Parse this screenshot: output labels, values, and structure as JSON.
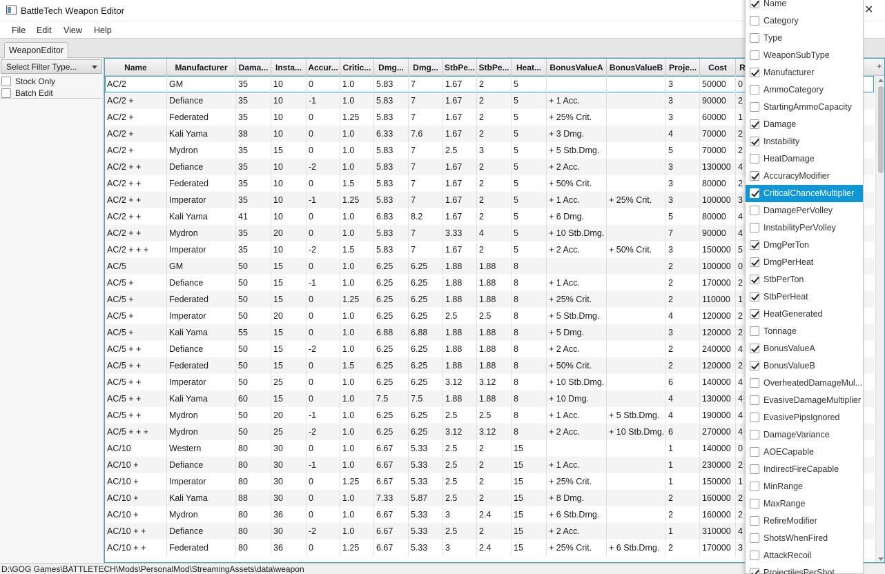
{
  "window": {
    "title": "BattleTech Weapon Editor",
    "close_glyph": "✕"
  },
  "menu": [
    "File",
    "Edit",
    "View",
    "Help"
  ],
  "tabs": [
    "WeaponEditor"
  ],
  "left_panel": {
    "filter_placeholder": "Select Filter Type...",
    "checkboxes": [
      {
        "label": "Stock Only",
        "checked": false
      },
      {
        "label": "Batch Edit",
        "checked": false
      }
    ]
  },
  "table": {
    "add_column_glyph": "+",
    "columns": [
      "Name",
      "Manufacturer",
      "Dama...",
      "Insta...",
      "Accur...",
      "Critic...",
      "Dmg...",
      "Dmg...",
      "StbPe...",
      "StbPe...",
      "Heat...",
      "BonusValueA",
      "BonusValueB",
      "Proje...",
      "Cost",
      "R"
    ],
    "rows": [
      [
        "AC/2",
        "GM",
        "35",
        "10",
        "0",
        "1.0",
        "5.83",
        "7",
        "1.67",
        "2",
        "5",
        "",
        "",
        "3",
        "50000",
        "0"
      ],
      [
        "AC/2 +",
        "Defiance",
        "35",
        "10",
        "-1",
        "1.0",
        "5.83",
        "7",
        "1.67",
        "2",
        "5",
        "+ 1 Acc.",
        "",
        "3",
        "90000",
        "2"
      ],
      [
        "AC/2 +",
        "Federated",
        "35",
        "10",
        "0",
        "1.25",
        "5.83",
        "7",
        "1.67",
        "2",
        "5",
        "+ 25% Crit.",
        "",
        "3",
        "60000",
        "1"
      ],
      [
        "AC/2 +",
        "Kali Yama",
        "38",
        "10",
        "0",
        "1.0",
        "6.33",
        "7.6",
        "1.67",
        "2",
        "5",
        "+ 3 Dmg.",
        "",
        "4",
        "70000",
        "2"
      ],
      [
        "AC/2 +",
        "Mydron",
        "35",
        "15",
        "0",
        "1.0",
        "5.83",
        "7",
        "2.5",
        "3",
        "5",
        "+ 5 Stb.Dmg.",
        "",
        "5",
        "70000",
        "2"
      ],
      [
        "AC/2 + +",
        "Defiance",
        "35",
        "10",
        "-2",
        "1.0",
        "5.83",
        "7",
        "1.67",
        "2",
        "5",
        "+ 2 Acc.",
        "",
        "3",
        "130000",
        "4"
      ],
      [
        "AC/2 + +",
        "Federated",
        "35",
        "10",
        "0",
        "1.5",
        "5.83",
        "7",
        "1.67",
        "2",
        "5",
        "+ 50% Crit.",
        "",
        "3",
        "80000",
        "2"
      ],
      [
        "AC/2 + +",
        "Imperator",
        "35",
        "10",
        "-1",
        "1.25",
        "5.83",
        "7",
        "1.67",
        "2",
        "5",
        "+ 1 Acc.",
        "+ 25% Crit.",
        "3",
        "100000",
        "3"
      ],
      [
        "AC/2 + +",
        "Kali Yama",
        "41",
        "10",
        "0",
        "1.0",
        "6.83",
        "8.2",
        "1.67",
        "2",
        "5",
        "+ 6 Dmg.",
        "",
        "5",
        "80000",
        "4"
      ],
      [
        "AC/2 + +",
        "Mydron",
        "35",
        "20",
        "0",
        "1.0",
        "5.83",
        "7",
        "3.33",
        "4",
        "5",
        "+ 10 Stb.Dmg.",
        "",
        "7",
        "90000",
        "4"
      ],
      [
        "AC/2 + + +",
        "Imperator",
        "35",
        "10",
        "-2",
        "1.5",
        "5.83",
        "7",
        "1.67",
        "2",
        "5",
        "+ 2 Acc.",
        "+ 50% Crit.",
        "3",
        "150000",
        "5"
      ],
      [
        "AC/5",
        "GM",
        "50",
        "15",
        "0",
        "1.0",
        "6.25",
        "6.25",
        "1.88",
        "1.88",
        "8",
        "",
        "",
        "2",
        "100000",
        "0"
      ],
      [
        "AC/5 +",
        "Defiance",
        "50",
        "15",
        "-1",
        "1.0",
        "6.25",
        "6.25",
        "1.88",
        "1.88",
        "8",
        "+ 1 Acc.",
        "",
        "2",
        "170000",
        "2"
      ],
      [
        "AC/5 +",
        "Federated",
        "50",
        "15",
        "0",
        "1.25",
        "6.25",
        "6.25",
        "1.88",
        "1.88",
        "8",
        "+ 25% Crit.",
        "",
        "2",
        "110000",
        "1"
      ],
      [
        "AC/5 +",
        "Imperator",
        "50",
        "20",
        "0",
        "1.0",
        "6.25",
        "6.25",
        "2.5",
        "2.5",
        "8",
        "+ 5 Stb.Dmg.",
        "",
        "4",
        "120000",
        "2"
      ],
      [
        "AC/5 +",
        "Kali Yama",
        "55",
        "15",
        "0",
        "1.0",
        "6.88",
        "6.88",
        "1.88",
        "1.88",
        "8",
        "+ 5 Dmg.",
        "",
        "3",
        "120000",
        "2"
      ],
      [
        "AC/5 + +",
        "Defiance",
        "50",
        "15",
        "-2",
        "1.0",
        "6.25",
        "6.25",
        "1.88",
        "1.88",
        "8",
        "+ 2 Acc.",
        "",
        "2",
        "240000",
        "4"
      ],
      [
        "AC/5 + +",
        "Federated",
        "50",
        "15",
        "0",
        "1.5",
        "6.25",
        "6.25",
        "1.88",
        "1.88",
        "8",
        "+ 50% Crit.",
        "",
        "2",
        "120000",
        "2"
      ],
      [
        "AC/5 + +",
        "Imperator",
        "50",
        "25",
        "0",
        "1.0",
        "6.25",
        "6.25",
        "3.12",
        "3.12",
        "8",
        "+ 10 Stb.Dmg.",
        "",
        "6",
        "140000",
        "4"
      ],
      [
        "AC/5 + +",
        "Kali Yama",
        "60",
        "15",
        "0",
        "1.0",
        "7.5",
        "7.5",
        "1.88",
        "1.88",
        "8",
        "+ 10 Dmg.",
        "",
        "4",
        "130000",
        "4"
      ],
      [
        "AC/5 + +",
        "Mydron",
        "50",
        "20",
        "-1",
        "1.0",
        "6.25",
        "6.25",
        "2.5",
        "2.5",
        "8",
        "+ 1 Acc.",
        "+ 5 Stb.Dmg.",
        "4",
        "190000",
        "4"
      ],
      [
        "AC/5 + + +",
        "Mydron",
        "50",
        "25",
        "-2",
        "1.0",
        "6.25",
        "6.25",
        "3.12",
        "3.12",
        "8",
        "+ 2 Acc.",
        "+ 10 Stb.Dmg.",
        "6",
        "270000",
        "4"
      ],
      [
        "AC/10",
        "Western",
        "80",
        "30",
        "0",
        "1.0",
        "6.67",
        "5.33",
        "2.5",
        "2",
        "15",
        "",
        "",
        "1",
        "140000",
        "0"
      ],
      [
        "AC/10 +",
        "Defiance",
        "80",
        "30",
        "-1",
        "1.0",
        "6.67",
        "5.33",
        "2.5",
        "2",
        "15",
        "+ 1 Acc.",
        "",
        "1",
        "230000",
        "2"
      ],
      [
        "AC/10 +",
        "Imperator",
        "80",
        "30",
        "0",
        "1.25",
        "6.67",
        "5.33",
        "2.5",
        "2",
        "15",
        "+ 25% Crit.",
        "",
        "1",
        "150000",
        "1"
      ],
      [
        "AC/10 +",
        "Kali Yama",
        "88",
        "30",
        "0",
        "1.0",
        "7.33",
        "5.87",
        "2.5",
        "2",
        "15",
        "+ 8 Dmg.",
        "",
        "2",
        "160000",
        "2"
      ],
      [
        "AC/10 +",
        "Mydron",
        "80",
        "36",
        "0",
        "1.0",
        "6.67",
        "5.33",
        "3",
        "2.4",
        "15",
        "+ 6 Stb.Dmg.",
        "",
        "2",
        "160000",
        "2"
      ],
      [
        "AC/10 + +",
        "Defiance",
        "80",
        "30",
        "-2",
        "1.0",
        "6.67",
        "5.33",
        "2.5",
        "2",
        "15",
        "+ 2 Acc.",
        "",
        "1",
        "310000",
        "4"
      ],
      [
        "AC/10 + +",
        "Federated",
        "80",
        "36",
        "0",
        "1.25",
        "6.67",
        "5.33",
        "3",
        "2.4",
        "15",
        "+ 25% Crit.",
        "+ 6 Stb.Dmg.",
        "2",
        "170000",
        "3"
      ]
    ]
  },
  "status_path": "D:\\GOG Games\\BATTLETECH\\Mods\\PersonalMod\\StreamingAssets\\data\\weapon",
  "column_menu": {
    "highlighted": "CriticalChanceMultiplier",
    "items": [
      {
        "label": "Name",
        "checked": true
      },
      {
        "label": "Category",
        "checked": false
      },
      {
        "label": "Type",
        "checked": false
      },
      {
        "label": "WeaponSubType",
        "checked": false
      },
      {
        "label": "Manufacturer",
        "checked": true
      },
      {
        "label": "AmmoCategory",
        "checked": false
      },
      {
        "label": "StartingAmmoCapacity",
        "checked": false
      },
      {
        "label": "Damage",
        "checked": true
      },
      {
        "label": "Instability",
        "checked": true
      },
      {
        "label": "HeatDamage",
        "checked": false
      },
      {
        "label": "AccuracyModifier",
        "checked": true
      },
      {
        "label": "CriticalChanceMultiplier",
        "checked": true
      },
      {
        "label": "DamagePerVolley",
        "checked": false
      },
      {
        "label": "InstabilityPerVolley",
        "checked": false
      },
      {
        "label": "DmgPerTon",
        "checked": true
      },
      {
        "label": "DmgPerHeat",
        "checked": true
      },
      {
        "label": "StbPerTon",
        "checked": true
      },
      {
        "label": "StbPerHeat",
        "checked": true
      },
      {
        "label": "HeatGenerated",
        "checked": true
      },
      {
        "label": "Tonnage",
        "checked": false
      },
      {
        "label": "BonusValueA",
        "checked": true
      },
      {
        "label": "BonusValueB",
        "checked": true
      },
      {
        "label": "OverheatedDamageMul...",
        "checked": false
      },
      {
        "label": "EvasiveDamageMultiplier",
        "checked": false
      },
      {
        "label": "EvasivePipsIgnored",
        "checked": false
      },
      {
        "label": "DamageVariance",
        "checked": false
      },
      {
        "label": "AOECapable",
        "checked": false
      },
      {
        "label": "IndirectFireCapable",
        "checked": false
      },
      {
        "label": "MinRange",
        "checked": false
      },
      {
        "label": "MaxRange",
        "checked": false
      },
      {
        "label": "RefireModifier",
        "checked": false
      },
      {
        "label": "ShotsWhenFired",
        "checked": false
      },
      {
        "label": "AttackRecoil",
        "checked": false
      },
      {
        "label": "ProjectilesPerShot",
        "checked": true
      }
    ]
  }
}
